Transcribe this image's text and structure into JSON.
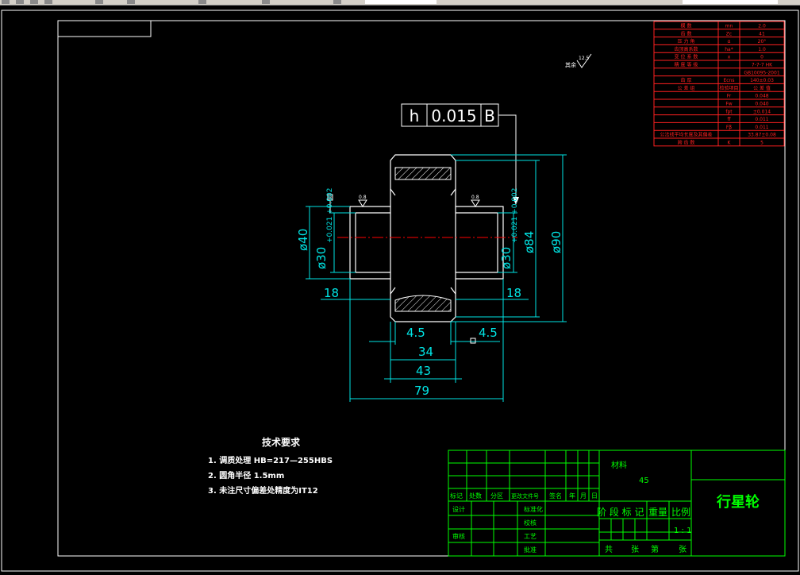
{
  "drawing": {
    "title": "行星轮",
    "material_label": "材料",
    "material_value": "45",
    "tolerance_frame": {
      "symbol": "h",
      "value": "0.015",
      "datum": "B"
    },
    "datum_label": "B",
    "roughness_symbol": "12.5",
    "roughness_note": "其余",
    "dimensions": {
      "d40": "ø40",
      "d30_left": "ø30",
      "d30_left_tol": "+0.021 +0.002",
      "d30_right": "ø30",
      "d30_right_tol": "+0.021 +0.002",
      "d84": "ø84",
      "d90": "ø90",
      "len18_left": "18",
      "len18_right": "18",
      "len4_5_left": "4.5",
      "len4_5_right": "4.5",
      "len34": "34",
      "len43": "43",
      "len79": "79"
    },
    "roughness_small_1": "0.8",
    "roughness_small_2": "0.8"
  },
  "tech_requirements": {
    "heading": "技术要求",
    "items": [
      "1. 调质处理 HB=217—255HBS",
      "2. 圆角半径  1.5mm",
      "3. 未注尺寸偏差处精度为IT12"
    ]
  },
  "title_block": {
    "row_labels": [
      "标记",
      "处数",
      "分区",
      "更改文件号",
      "签名",
      "年",
      "月",
      "日"
    ],
    "design": "设计",
    "standardize": "标准化",
    "review": "审核",
    "proofread": "校核",
    "process": "工艺",
    "approve": "批准",
    "stage_mark": "阶 段 标 记",
    "weight": "重量",
    "scale": "比例",
    "scale_value": "1 : 1",
    "sheet_total": "共",
    "sheet_unit_1": "张",
    "sheet_no": "第",
    "sheet_unit_2": "张"
  },
  "param_table": {
    "rows": [
      {
        "name": "模 数",
        "sym": "mn",
        "val": "2.0"
      },
      {
        "name": "齿 数",
        "sym": "Zc",
        "val": "41"
      },
      {
        "name": "压 力 角",
        "sym": "α",
        "val": "20°"
      },
      {
        "name": "齿顶高系数",
        "sym": "ha*",
        "val": "1.0"
      },
      {
        "name": "变 位 系 数",
        "sym": "x",
        "val": "0"
      },
      {
        "name": "精 度 等 级",
        "sym": "",
        "val": "7-7-7 HK"
      },
      {
        "name": "",
        "sym": "",
        "val": "GB10095-2001"
      },
      {
        "name": "齿 厚",
        "sym": "Ecns",
        "val": "140±0.03"
      },
      {
        "name": "公 差 组",
        "sym": "检验项目",
        "val": "公 差 值"
      },
      {
        "name": "",
        "sym": "Fr",
        "val": "0.048"
      },
      {
        "name": "",
        "sym": "Fw",
        "val": "0.040"
      },
      {
        "name": "",
        "sym": "fpt",
        "val": "±0.014"
      },
      {
        "name": "",
        "sym": "ff",
        "val": "0.011"
      },
      {
        "name": "",
        "sym": "Fβ",
        "val": "0.011"
      },
      {
        "name": "公法线平均长度及其偏差",
        "sym": "",
        "val": "33.87±0.08"
      },
      {
        "name": "跨 齿 数",
        "sym": "K",
        "val": "5"
      }
    ]
  },
  "colors": {
    "frame": "#ffffff",
    "dimension": "#00e5e5",
    "table_red": "#ff2020",
    "title_green": "#00ff00",
    "hatch": "#ffffff",
    "center": "#ff0000"
  }
}
